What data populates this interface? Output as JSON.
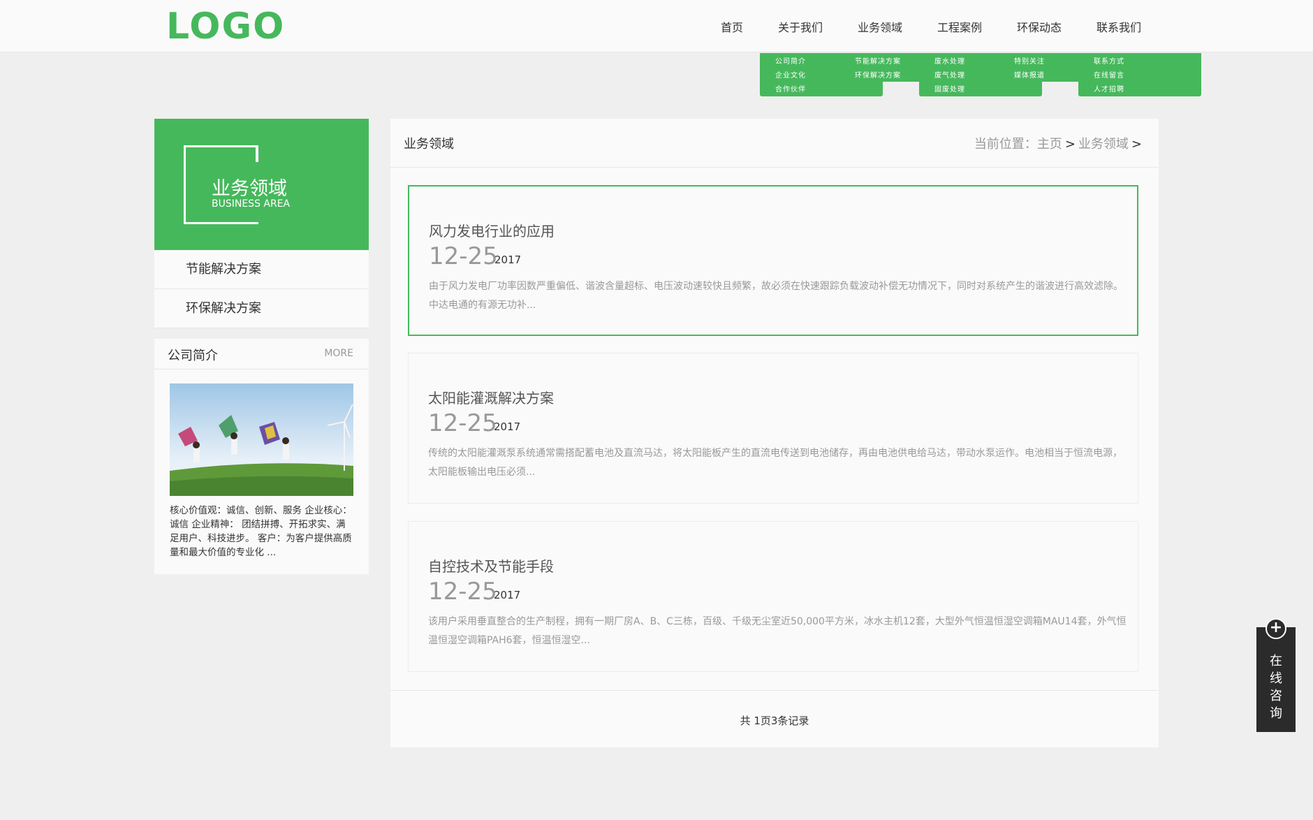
{
  "header": {
    "logo": "LOGO",
    "nav": [
      "首页",
      "关于我们",
      "业务领域",
      "工程案例",
      "环保动态",
      "联系我们"
    ]
  },
  "dropdown": [
    [
      "公司简介",
      "企业文化",
      "合作伙伴"
    ],
    [
      "节能解决方案",
      "环保解决方案"
    ],
    [
      "废水处理",
      "废气处理",
      "固废处理"
    ],
    [
      "特别关注",
      "媒体报道"
    ],
    [
      "联系方式",
      "在线留言",
      "人才招聘"
    ]
  ],
  "sidebar": {
    "banner_title": "业务领域",
    "banner_sub": "BUSINESS AREA",
    "menu": [
      "节能解决方案",
      "环保解决方案"
    ],
    "company": {
      "title": "公司简介",
      "more": "MORE",
      "text": "核心价值观：诚信、创新、服务 企业核心： 诚信 企业精神： 团结拼搏、开拓求实、满足用户、科技进步。 客户：为客户提供高质量和最大价值的专业化 ..."
    }
  },
  "main": {
    "title": "业务领域",
    "crumb_prefix": "当前位置：",
    "crumb_home": "主页",
    "crumb_current": "业务领域",
    "crumb_sep": ">",
    "articles": [
      {
        "title": "风力发电行业的应用",
        "date": "12-25",
        "year": "2017",
        "desc": "由于风力发电厂功率因数严重偏低、谐波含量超标、电压波动速较快且频繁，故必须在快速跟踪负载波动补偿无功情况下，同时对系统产生的谐波进行高效滤除。中达电通的有源无功补..."
      },
      {
        "title": "太阳能灌溉解决方案",
        "date": "12-25",
        "year": "2017",
        "desc": "传统的太阳能灌溉泵系统通常需搭配蓄电池及直流马达，将太阳能板产生的直流电传送到电池储存，再由电池供电给马达，带动水泵运作。电池相当于恒流电源，太阳能板输出电压必须..."
      },
      {
        "title": "自控技术及节能手段",
        "date": "12-25",
        "year": "2017",
        "desc": "该用户采用垂直整合的生产制程，拥有一期厂房A、B、C三栋，百级、千级无尘室近50,000平方米，冰水主机12套，大型外气恒温恒湿空调箱MAU14套，外气恒温恒湿空调箱PAH6套，恒温恒湿空..."
      }
    ],
    "pager": "共 1页3条记录"
  },
  "consult": {
    "plus": "+",
    "chars": [
      "在",
      "线",
      "咨",
      "询"
    ]
  },
  "colors": {
    "brand_green": "#46b85c",
    "consult_bg": "#2b2b2b",
    "page_bg": "#efefef"
  }
}
